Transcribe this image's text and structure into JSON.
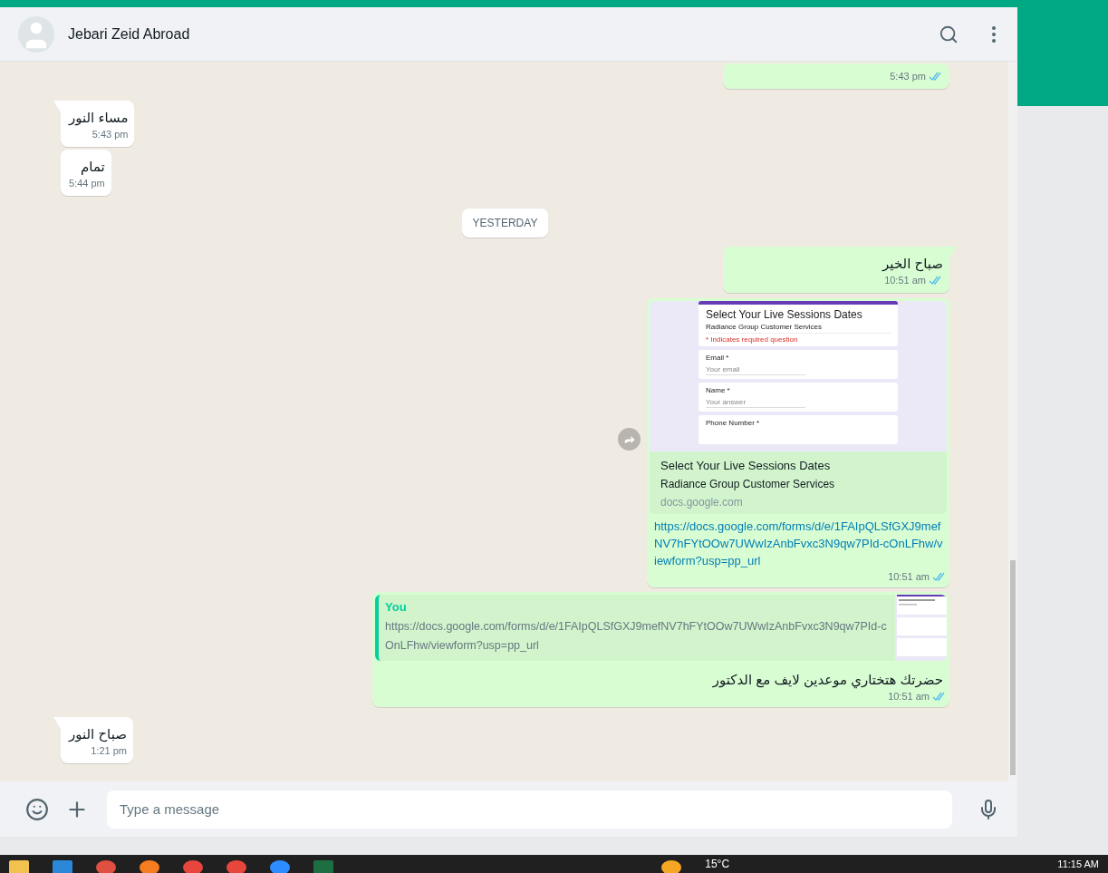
{
  "chat_header": {
    "contact_name": "Jebari Zeid Abroad"
  },
  "messages": [
    {
      "kind": "outgoing",
      "time": "5:43 pm",
      "read": true
    },
    {
      "kind": "incoming",
      "text": "مساء النور",
      "time": "5:43 pm",
      "tail": true
    },
    {
      "kind": "incoming",
      "text": "تمام",
      "time": "5:44 pm",
      "tail": false
    },
    {
      "kind": "date",
      "text": "YESTERDAY"
    },
    {
      "kind": "outgoing",
      "text": "صباح الخير",
      "time": "10:51 am",
      "read": true,
      "tail": true
    },
    {
      "kind": "link",
      "preview_image": {
        "form_title": "Select Your Live Sessions Dates",
        "form_subtitle": "Radiance Group Customer Services",
        "required_note": "* Indicates required question",
        "fields": [
          {
            "label": "Email *",
            "placeholder": "Your email"
          },
          {
            "label": "Name *",
            "placeholder": "Your answer"
          },
          {
            "label": "Phone Number *"
          }
        ]
      },
      "preview_title": "Select Your Live Sessions Dates",
      "preview_description": "Radiance Group Customer Services",
      "preview_domain": "docs.google.com",
      "url": "https://docs.google.com/forms/d/e/1FAIpQLSfGXJ9mefNV7hFYtOOw7UWwIzAnbFvxc3N9qw7PId-cOnLFhw/viewform?usp=pp_url",
      "time": "10:51 am",
      "read": true
    },
    {
      "kind": "quote",
      "quote_author": "You",
      "quote_text": "https://docs.google.com/forms/d/e/1FAIpQLSfGXJ9mefNV7hFYtOOw7UWwIzAnbFvxc3N9qw7PId-cOnLFhw/viewform?usp=pp_url",
      "text": "حضرتك هتختاري موعدين لايف مع الدكتور",
      "time": "10:51 am",
      "read": true
    },
    {
      "kind": "incoming",
      "text": "صباح النور",
      "time": "1:21 pm",
      "tail": true
    }
  ],
  "composer": {
    "placeholder": "Type a message"
  },
  "taskbar": {
    "weather": "15°C",
    "clock": "11:15 AM"
  }
}
